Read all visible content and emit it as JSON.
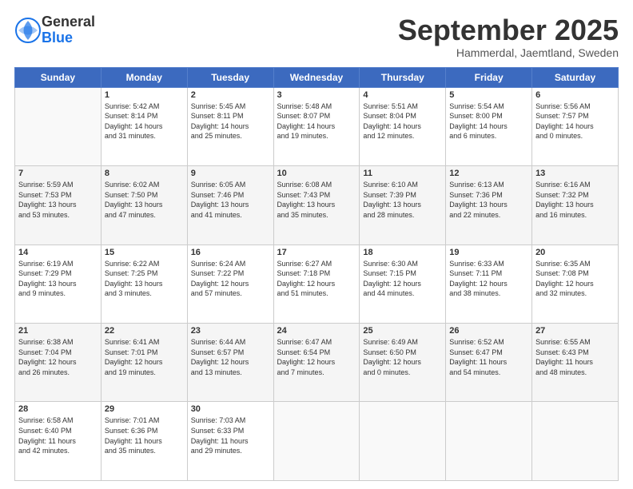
{
  "header": {
    "logo": {
      "line1": "General",
      "line2": "Blue"
    },
    "title": "September 2025",
    "location": "Hammerdal, Jaemtland, Sweden"
  },
  "weekdays": [
    "Sunday",
    "Monday",
    "Tuesday",
    "Wednesday",
    "Thursday",
    "Friday",
    "Saturday"
  ],
  "weeks": [
    [
      {
        "day": "",
        "info": ""
      },
      {
        "day": "1",
        "info": "Sunrise: 5:42 AM\nSunset: 8:14 PM\nDaylight: 14 hours\nand 31 minutes."
      },
      {
        "day": "2",
        "info": "Sunrise: 5:45 AM\nSunset: 8:11 PM\nDaylight: 14 hours\nand 25 minutes."
      },
      {
        "day": "3",
        "info": "Sunrise: 5:48 AM\nSunset: 8:07 PM\nDaylight: 14 hours\nand 19 minutes."
      },
      {
        "day": "4",
        "info": "Sunrise: 5:51 AM\nSunset: 8:04 PM\nDaylight: 14 hours\nand 12 minutes."
      },
      {
        "day": "5",
        "info": "Sunrise: 5:54 AM\nSunset: 8:00 PM\nDaylight: 14 hours\nand 6 minutes."
      },
      {
        "day": "6",
        "info": "Sunrise: 5:56 AM\nSunset: 7:57 PM\nDaylight: 14 hours\nand 0 minutes."
      }
    ],
    [
      {
        "day": "7",
        "info": "Sunrise: 5:59 AM\nSunset: 7:53 PM\nDaylight: 13 hours\nand 53 minutes."
      },
      {
        "day": "8",
        "info": "Sunrise: 6:02 AM\nSunset: 7:50 PM\nDaylight: 13 hours\nand 47 minutes."
      },
      {
        "day": "9",
        "info": "Sunrise: 6:05 AM\nSunset: 7:46 PM\nDaylight: 13 hours\nand 41 minutes."
      },
      {
        "day": "10",
        "info": "Sunrise: 6:08 AM\nSunset: 7:43 PM\nDaylight: 13 hours\nand 35 minutes."
      },
      {
        "day": "11",
        "info": "Sunrise: 6:10 AM\nSunset: 7:39 PM\nDaylight: 13 hours\nand 28 minutes."
      },
      {
        "day": "12",
        "info": "Sunrise: 6:13 AM\nSunset: 7:36 PM\nDaylight: 13 hours\nand 22 minutes."
      },
      {
        "day": "13",
        "info": "Sunrise: 6:16 AM\nSunset: 7:32 PM\nDaylight: 13 hours\nand 16 minutes."
      }
    ],
    [
      {
        "day": "14",
        "info": "Sunrise: 6:19 AM\nSunset: 7:29 PM\nDaylight: 13 hours\nand 9 minutes."
      },
      {
        "day": "15",
        "info": "Sunrise: 6:22 AM\nSunset: 7:25 PM\nDaylight: 13 hours\nand 3 minutes."
      },
      {
        "day": "16",
        "info": "Sunrise: 6:24 AM\nSunset: 7:22 PM\nDaylight: 12 hours\nand 57 minutes."
      },
      {
        "day": "17",
        "info": "Sunrise: 6:27 AM\nSunset: 7:18 PM\nDaylight: 12 hours\nand 51 minutes."
      },
      {
        "day": "18",
        "info": "Sunrise: 6:30 AM\nSunset: 7:15 PM\nDaylight: 12 hours\nand 44 minutes."
      },
      {
        "day": "19",
        "info": "Sunrise: 6:33 AM\nSunset: 7:11 PM\nDaylight: 12 hours\nand 38 minutes."
      },
      {
        "day": "20",
        "info": "Sunrise: 6:35 AM\nSunset: 7:08 PM\nDaylight: 12 hours\nand 32 minutes."
      }
    ],
    [
      {
        "day": "21",
        "info": "Sunrise: 6:38 AM\nSunset: 7:04 PM\nDaylight: 12 hours\nand 26 minutes."
      },
      {
        "day": "22",
        "info": "Sunrise: 6:41 AM\nSunset: 7:01 PM\nDaylight: 12 hours\nand 19 minutes."
      },
      {
        "day": "23",
        "info": "Sunrise: 6:44 AM\nSunset: 6:57 PM\nDaylight: 12 hours\nand 13 minutes."
      },
      {
        "day": "24",
        "info": "Sunrise: 6:47 AM\nSunset: 6:54 PM\nDaylight: 12 hours\nand 7 minutes."
      },
      {
        "day": "25",
        "info": "Sunrise: 6:49 AM\nSunset: 6:50 PM\nDaylight: 12 hours\nand 0 minutes."
      },
      {
        "day": "26",
        "info": "Sunrise: 6:52 AM\nSunset: 6:47 PM\nDaylight: 11 hours\nand 54 minutes."
      },
      {
        "day": "27",
        "info": "Sunrise: 6:55 AM\nSunset: 6:43 PM\nDaylight: 11 hours\nand 48 minutes."
      }
    ],
    [
      {
        "day": "28",
        "info": "Sunrise: 6:58 AM\nSunset: 6:40 PM\nDaylight: 11 hours\nand 42 minutes."
      },
      {
        "day": "29",
        "info": "Sunrise: 7:01 AM\nSunset: 6:36 PM\nDaylight: 11 hours\nand 35 minutes."
      },
      {
        "day": "30",
        "info": "Sunrise: 7:03 AM\nSunset: 6:33 PM\nDaylight: 11 hours\nand 29 minutes."
      },
      {
        "day": "",
        "info": ""
      },
      {
        "day": "",
        "info": ""
      },
      {
        "day": "",
        "info": ""
      },
      {
        "day": "",
        "info": ""
      }
    ]
  ]
}
